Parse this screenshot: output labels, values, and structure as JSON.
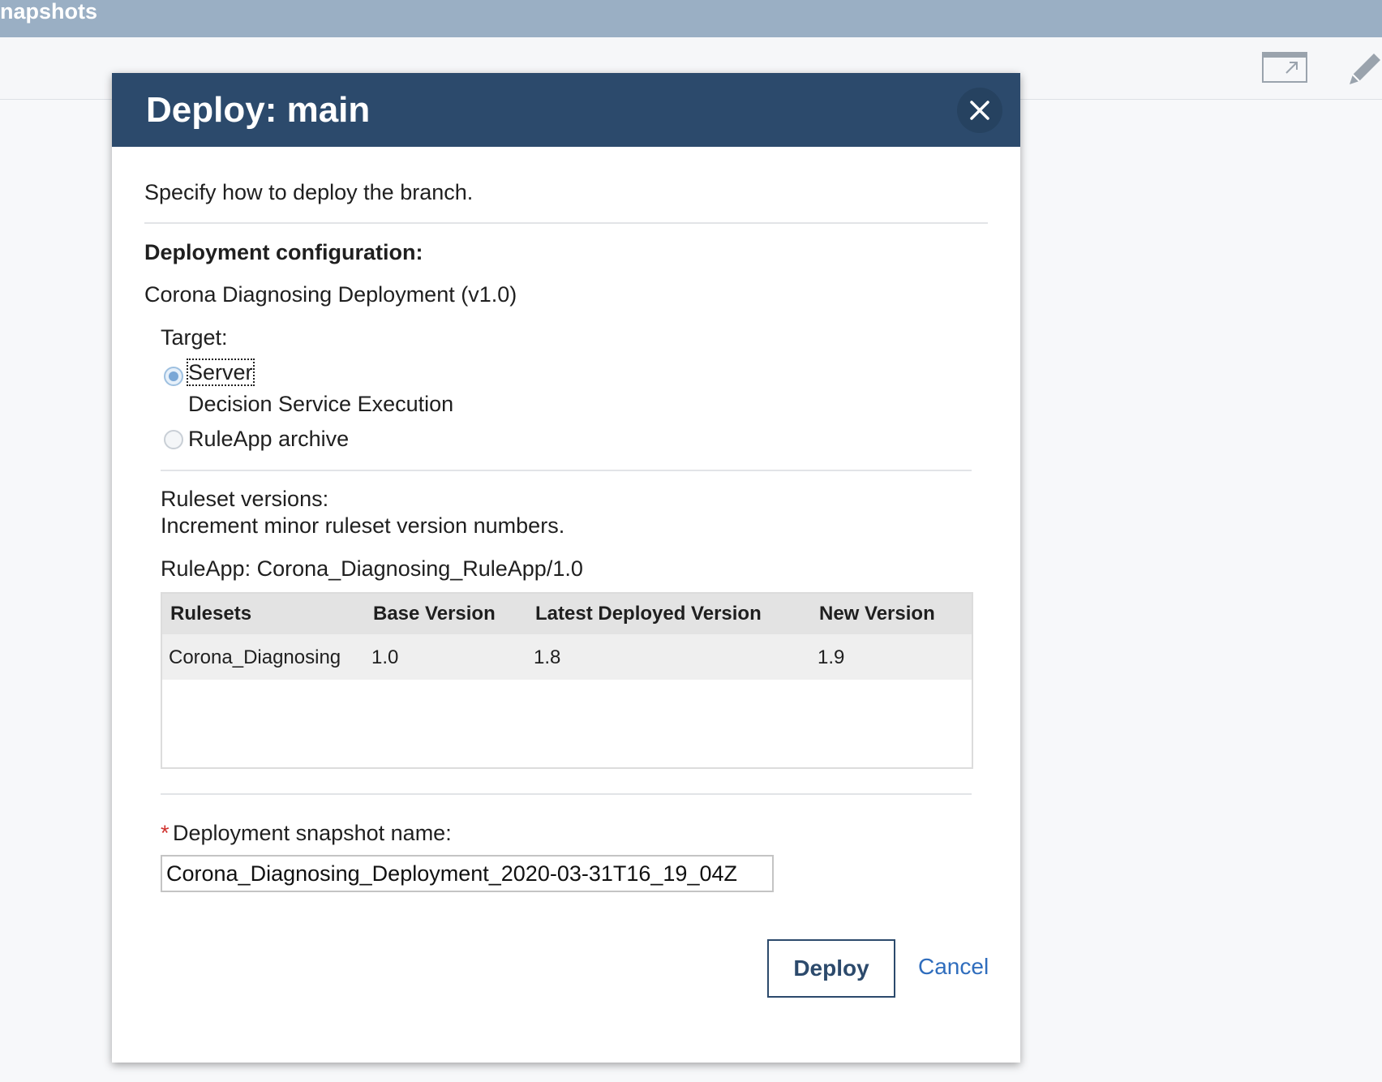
{
  "app": {
    "header_title": "napshots"
  },
  "toolbar": {
    "popout_icon": "popout-icon",
    "edit_icon": "pencil-icon"
  },
  "dialog": {
    "title": "Deploy: main",
    "close_icon": "close-icon",
    "intro": "Specify how to deploy the branch.",
    "config_heading": "Deployment configuration:",
    "config_name": "Corona Diagnosing Deployment (v1.0)",
    "target_label": "Target:",
    "target_options": [
      {
        "label": "Server",
        "selected": true,
        "description": "Decision Service Execution"
      },
      {
        "label": "RuleApp archive",
        "selected": false
      }
    ],
    "ruleset_versions_label": "Ruleset versions:",
    "ruleset_versions_desc": "Increment minor ruleset version numbers.",
    "ruleapp_label": "RuleApp: Corona_Diagnosing_RuleApp/1.0",
    "table": {
      "columns": [
        "Rulesets",
        "Base Version",
        "Latest Deployed Version",
        "New Version"
      ],
      "rows": [
        [
          "Corona_Diagnosing",
          "1.0",
          "1.8",
          "1.9"
        ]
      ]
    },
    "snapshot_label": "Deployment snapshot name:",
    "required_marker": "*",
    "snapshot_value": "Corona_Diagnosing_Deployment_2020-03-31T16_19_04Z",
    "deploy_label": "Deploy",
    "cancel_label": "Cancel"
  },
  "colors": {
    "header_bg": "#9aafc4",
    "dialog_header_bg": "#2c4a6c",
    "link": "#2f6dbd",
    "required": "#d0312d"
  }
}
